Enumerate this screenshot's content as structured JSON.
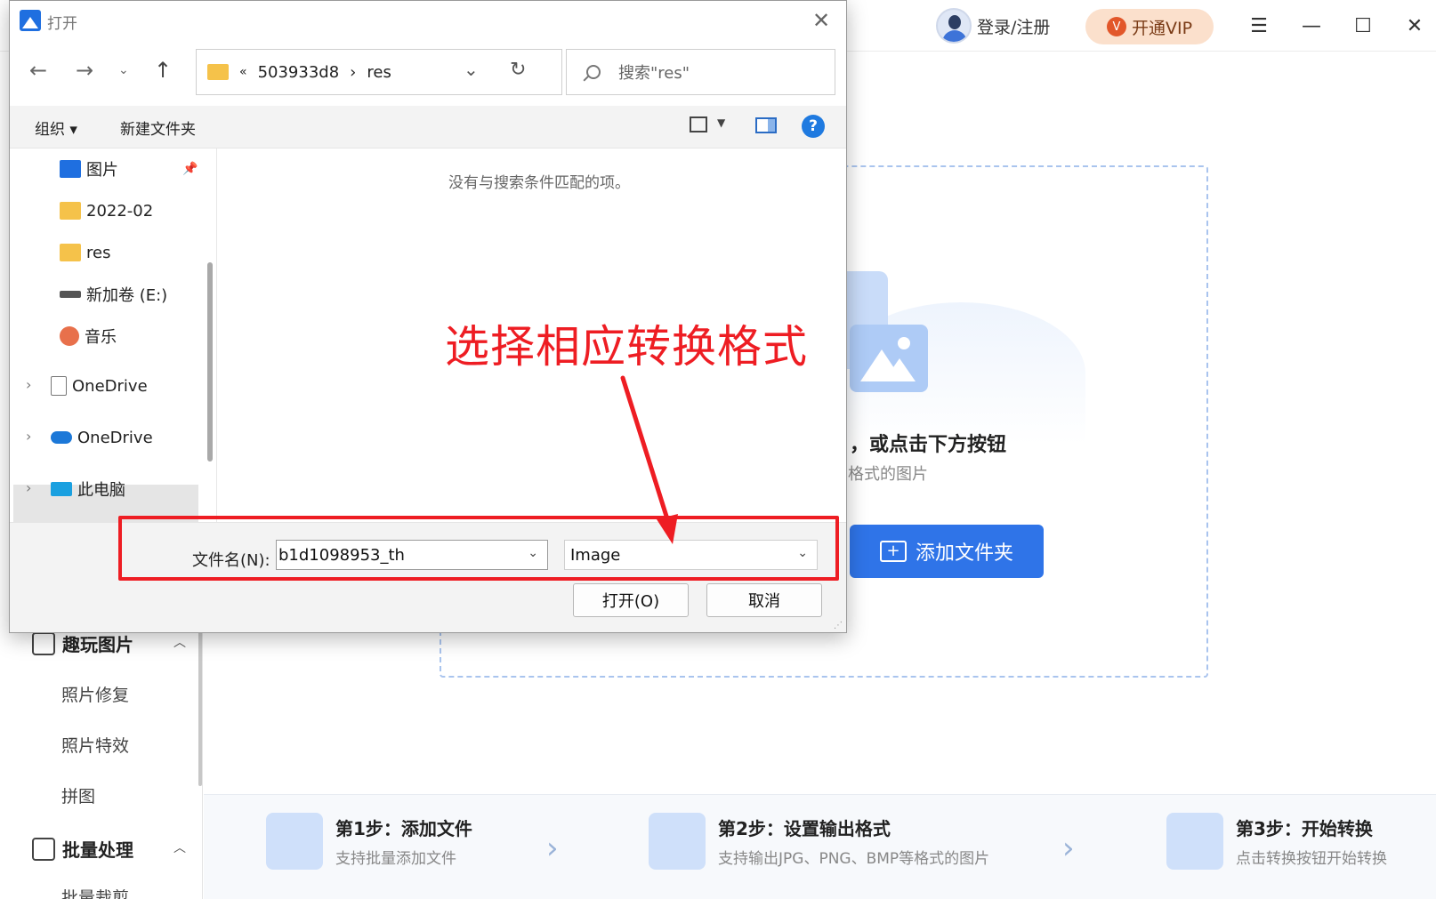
{
  "app": {
    "user": {
      "login_label": "登录/注册"
    },
    "vip": {
      "label": "开通VIP",
      "icon": "vip-badge-icon"
    },
    "window_controls": {
      "menu": "☰",
      "minimize": "—",
      "maximize": "☐",
      "close": "✕"
    },
    "sidebar": {
      "groups": [
        {
          "label": "趣玩图片",
          "icon": "sparkle-image-icon",
          "items": [
            "照片修复",
            "照片特效",
            "拼图"
          ]
        },
        {
          "label": "批量处理",
          "icon": "batch-check-icon",
          "items": [
            "批量裁剪"
          ]
        }
      ]
    },
    "dropzone": {
      "heading": "，或点击下方按钮",
      "subheading": "格式的图片",
      "add_folder_label": "添加文件夹"
    },
    "steps": [
      {
        "title": "第1步：添加文件",
        "desc": "支持批量添加文件",
        "icon": "add-image-icon"
      },
      {
        "title": "第2步：设置输出格式",
        "desc": "支持输出JPG、PNG、BMP等格式的图片",
        "icon": "gear-image-icon"
      },
      {
        "title": "第3步：开始转换",
        "desc": "点击转换按钮开始转换",
        "icon": "convert-doc-icon"
      }
    ],
    "colors": {
      "accent": "#2f74e8",
      "annotation": "#ee1d23",
      "vip_bg": "#fbe0cc"
    }
  },
  "dialog": {
    "title": "打开",
    "address": {
      "overflow": "«",
      "segments": [
        "503933d8",
        "res"
      ],
      "separator": "›"
    },
    "search_placeholder": "搜索\"res\"",
    "toolbar": {
      "organize": "组织 ▾",
      "new_folder": "新建文件夹",
      "help": "?"
    },
    "nav_items": [
      {
        "label": "图片",
        "icon": "pictures-icon",
        "pinned": true
      },
      {
        "label": "2022-02",
        "icon": "folder-icon"
      },
      {
        "label": "res",
        "icon": "folder-icon"
      },
      {
        "label": "新加卷 (E:)",
        "icon": "drive-icon"
      },
      {
        "label": "音乐",
        "icon": "music-icon"
      },
      {
        "label": "OneDrive",
        "icon": "document-icon"
      },
      {
        "label": "OneDrive",
        "icon": "cloud-icon"
      },
      {
        "label": "此电脑",
        "icon": "computer-icon"
      }
    ],
    "empty_message": "没有与搜索条件匹配的项。",
    "filename_label": "文件名(N):",
    "filename_value": "b1d1098953_th",
    "filetype_value": "Image",
    "open_label": "打开(O)",
    "cancel_label": "取消"
  },
  "annotation": {
    "text": "选择相应转换格式"
  }
}
